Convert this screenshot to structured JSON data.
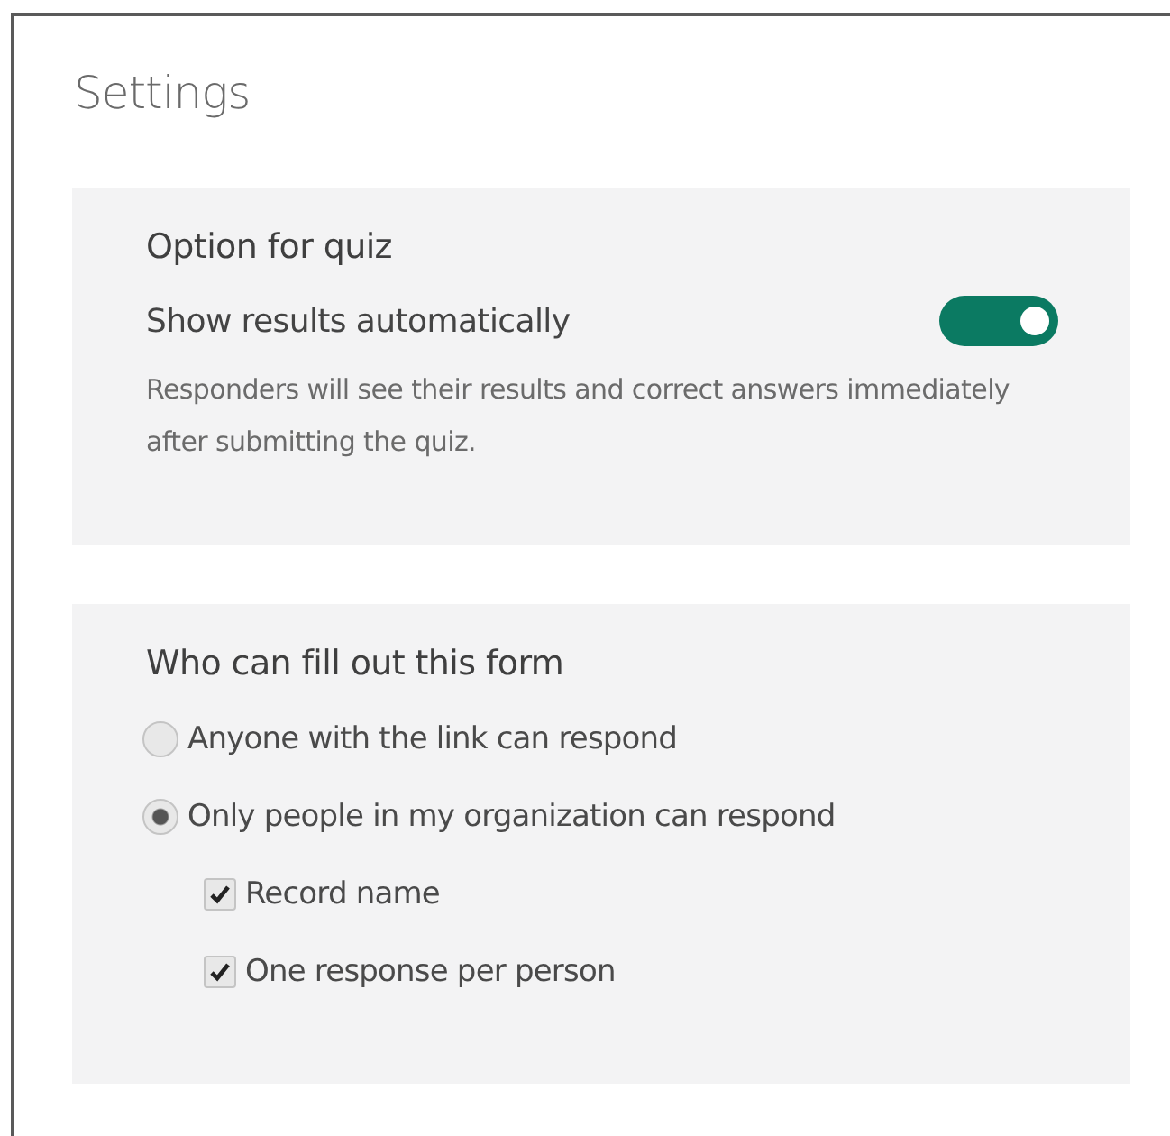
{
  "panel": {
    "title": "Settings"
  },
  "quiz_options": {
    "heading": "Option for quiz",
    "toggle": {
      "label": "Show results automatically",
      "on": true
    },
    "description": "Responders will see their results and correct answers immediately after submitting the quiz."
  },
  "who_can_fill": {
    "heading": "Who can fill out this form",
    "options": [
      {
        "label": "Anyone with the link can respond",
        "selected": false
      },
      {
        "label": "Only people in my organization can respond",
        "selected": true,
        "suboptions": [
          {
            "label": "Record name",
            "checked": true
          },
          {
            "label": "One response per person",
            "checked": true
          }
        ]
      }
    ]
  }
}
